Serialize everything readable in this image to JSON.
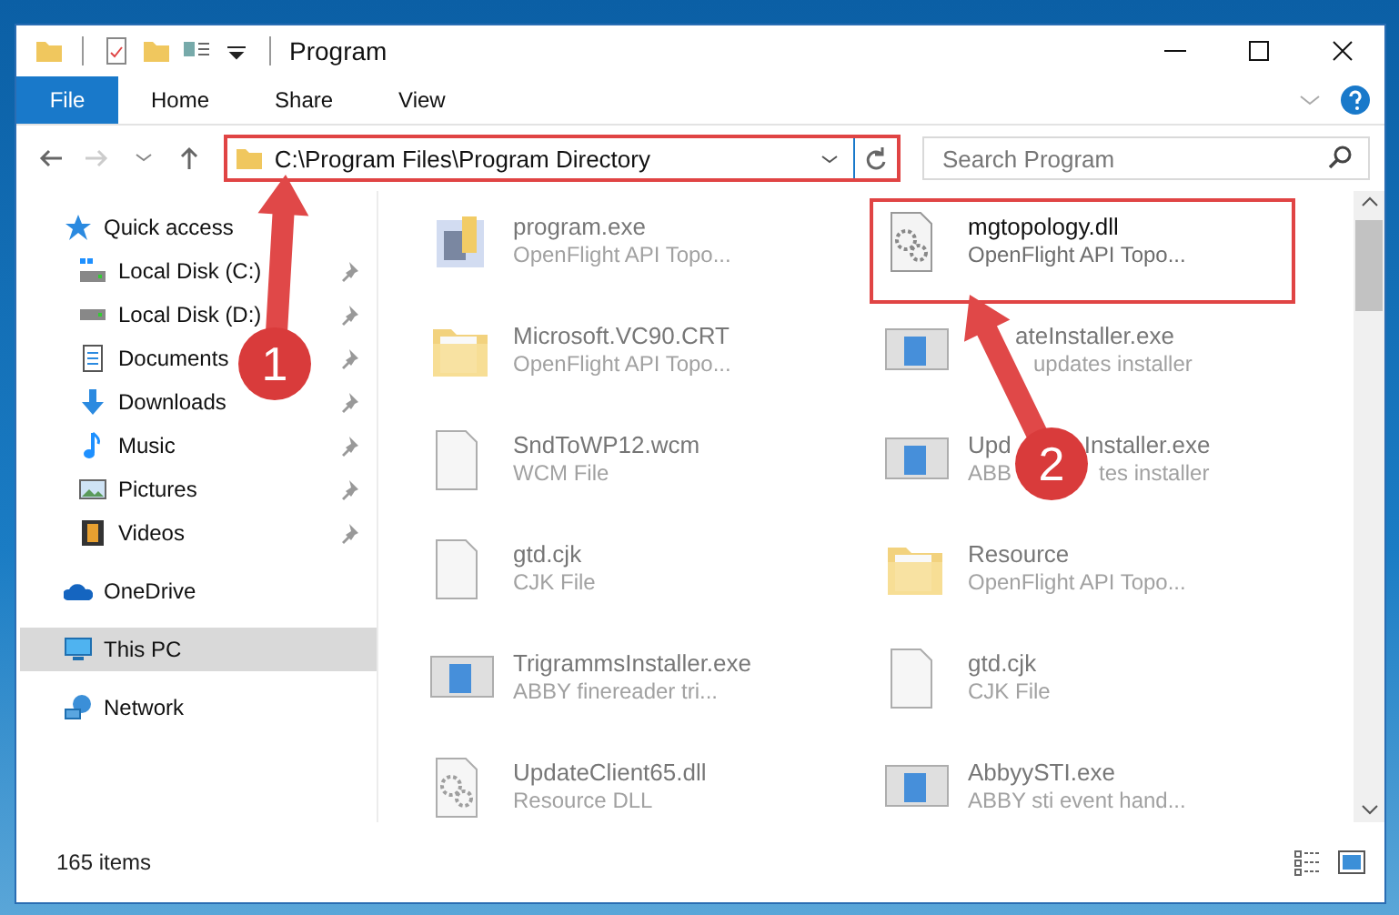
{
  "window": {
    "title": "Program"
  },
  "ribbon_tabs": [
    {
      "label": "File",
      "selected": true
    },
    {
      "label": "Home",
      "selected": false
    },
    {
      "label": "Share",
      "selected": false
    },
    {
      "label": "View",
      "selected": false
    }
  ],
  "address": {
    "path": "C:\\Program Files\\Program Directory",
    "highlighted": true
  },
  "search": {
    "placeholder": "Search Program"
  },
  "sidebar": {
    "items": [
      {
        "label": "Quick access",
        "selected": false,
        "children": [
          {
            "label": "Local Disk (C:)",
            "pinned": true
          },
          {
            "label": "Local Disk (D:)",
            "pinned": true
          },
          {
            "label": "Documents",
            "pinned": true
          },
          {
            "label": "Downloads",
            "pinned": true
          },
          {
            "label": "Music",
            "pinned": true
          },
          {
            "label": "Pictures",
            "pinned": true
          },
          {
            "label": "Videos",
            "pinned": true
          }
        ]
      },
      {
        "label": "OneDrive",
        "selected": false
      },
      {
        "label": "This PC",
        "selected": true
      },
      {
        "label": "Network",
        "selected": false
      }
    ]
  },
  "files": [
    {
      "name": "program.exe",
      "description": "OpenFlight API Topo...",
      "kind": "app",
      "dimmed": true,
      "highlighted": false
    },
    {
      "name": "mgtopology.dll",
      "description": "OpenFlight API Topo...",
      "kind": "dll",
      "dimmed": false,
      "highlighted": true
    },
    {
      "name": "Microsoft.VC90.CRT",
      "description": "OpenFlight API Topo...",
      "kind": "folder",
      "dimmed": true,
      "highlighted": false
    },
    {
      "name_parts": [
        "ateInstaller.exe"
      ],
      "description_parts": [
        "updates installer"
      ],
      "kind": "installer",
      "dimmed": true,
      "highlighted": false
    },
    {
      "name": "SndToWP12.wcm",
      "description": "WCM File",
      "kind": "blank",
      "dimmed": true,
      "highlighted": false
    },
    {
      "name_parts": [
        "Upd",
        "Installer.exe"
      ],
      "description_parts": [
        "ABB",
        "tes installer"
      ],
      "kind": "installer",
      "dimmed": true,
      "highlighted": false
    },
    {
      "name": "gtd.cjk",
      "description": "CJK File",
      "kind": "blank",
      "dimmed": true,
      "highlighted": false
    },
    {
      "name": "Resource",
      "description": "OpenFlight API Topo...",
      "kind": "folder",
      "dimmed": true,
      "highlighted": false
    },
    {
      "name": "TrigrammsInstaller.exe",
      "description": "ABBY finereader tri...",
      "kind": "installer",
      "dimmed": true,
      "highlighted": false
    },
    {
      "name": "gtd.cjk",
      "description": "CJK File",
      "kind": "blank",
      "dimmed": true,
      "highlighted": false
    },
    {
      "name": "UpdateClient65.dll",
      "description": "Resource DLL",
      "kind": "dll",
      "dimmed": true,
      "highlighted": false
    },
    {
      "name": "AbbyySTI.exe",
      "description": "ABBY sti event hand...",
      "kind": "installer",
      "dimmed": true,
      "highlighted": false
    }
  ],
  "status_bar": {
    "item_count": "165 items"
  },
  "callouts": [
    {
      "number": "1"
    },
    {
      "number": "2"
    }
  ]
}
